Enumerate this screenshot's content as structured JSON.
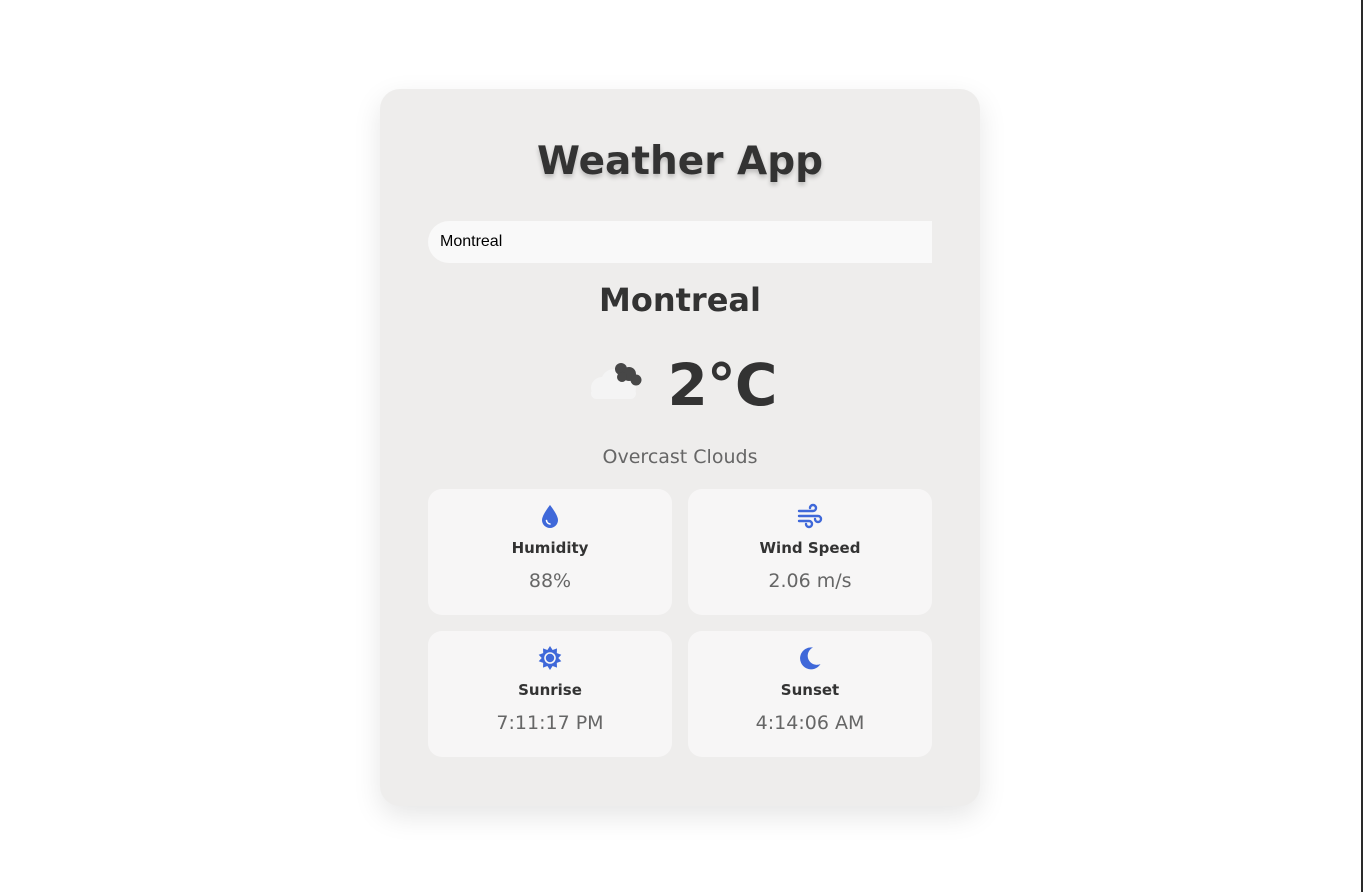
{
  "app": {
    "title": "Weather App"
  },
  "search": {
    "value": "Montreal"
  },
  "weather": {
    "city": "Montreal",
    "temperature": "2°C",
    "description": "Overcast Clouds",
    "icon": "overcast-clouds-icon"
  },
  "details": [
    {
      "icon": "droplet-icon",
      "label": "Humidity",
      "value": "88%"
    },
    {
      "icon": "wind-icon",
      "label": "Wind Speed",
      "value": "2.06 m/s"
    },
    {
      "icon": "sun-icon",
      "label": "Sunrise",
      "value": "7:11:17 PM"
    },
    {
      "icon": "moon-icon",
      "label": "Sunset",
      "value": "4:14:06 AM"
    }
  ],
  "colors": {
    "accent": "#3f68d9",
    "card_background": "#eeedec",
    "detail_background": "#f7f6f6",
    "text_primary": "#333333",
    "text_secondary": "#666666"
  }
}
